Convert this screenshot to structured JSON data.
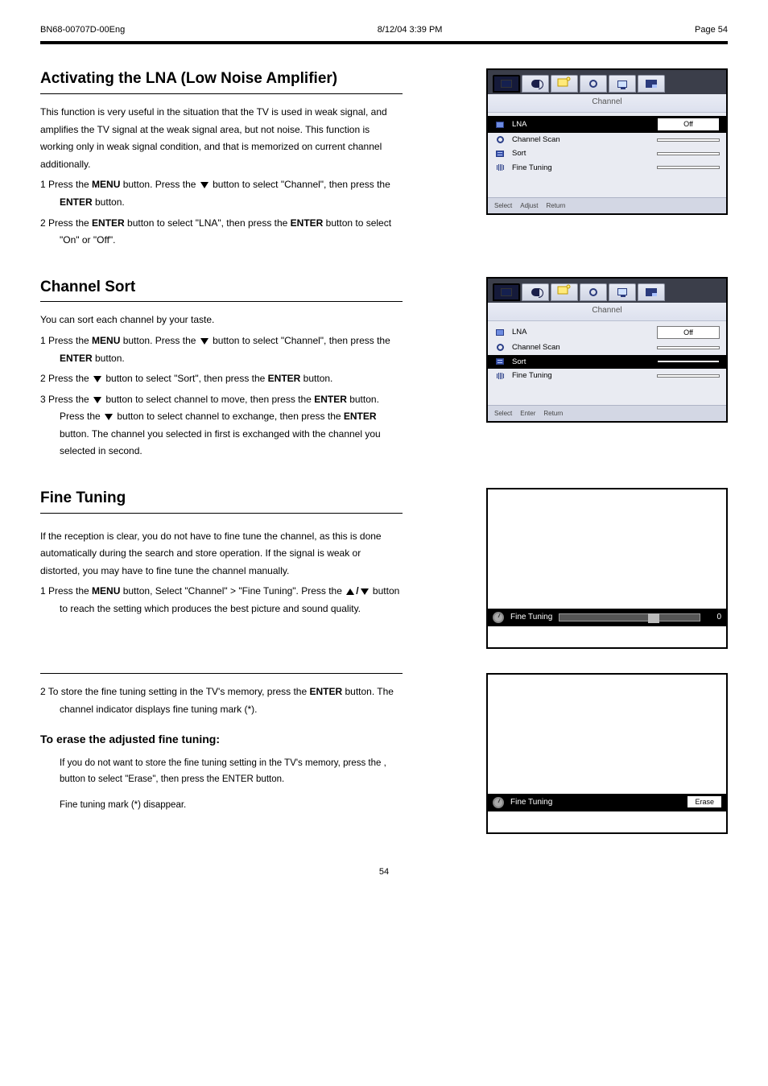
{
  "header": {
    "left": "BN68-00707D-00Eng",
    "middle": "8/12/04 3:39 PM",
    "right": "Page 54"
  },
  "section1": {
    "heading": "Activating the LNA (Low Noise Amplifier)",
    "intro": "This function is very useful in the situation that the TV is used in weak signal, and amplifies the TV signal at the weak signal area, but not noise.  This function is working only in weak signal condition, and that is memorized on current channel additionally.",
    "step1_pre": "1  Press the ",
    "menu": "MENU",
    "step1_mid": " button.\nPress the ",
    "step1_mid2": " button to select \"Channel\", then press\nthe ",
    "enter": "ENTER",
    "step1_end": " button.",
    "step2_pre": "2  Press the ",
    "step2_mid": " button to select \"LNA\", then press\nthe ",
    "step2_end": " button to select \"On\" or \"Off\"."
  },
  "osd1": {
    "title": "Channel",
    "rows": [
      {
        "label": "LNA",
        "value": "Off",
        "highlight": true
      },
      {
        "label": "Channel Scan",
        "value": "",
        "highlight": false
      },
      {
        "label": "Sort",
        "value": "",
        "highlight": false
      },
      {
        "label": "Fine Tuning",
        "value": "",
        "highlight": false
      }
    ],
    "footer": [
      "Select",
      "Adjust",
      "Return"
    ]
  },
  "section2": {
    "heading": "Channel Sort",
    "intro": "You can sort each channel by your taste.",
    "step1": {
      "pre": "1  Press the ",
      "menu": "MENU",
      "mid1": " button.\nPress the ",
      "mid2": " button to select \"Channel\", then press\nthe ",
      "enter": "ENTER",
      "end": " button."
    },
    "step2_pre": "2  Press the ",
    "step2_mid": " button to select \"Sort\", then press the\n",
    "step2_end": " button.",
    "step3_pre": "3  Press the ",
    "step3_mid": " button to select channel to move, then\npress the ",
    "step3_mid2": " button.\nPress the ",
    "step3_mid3": " button to select channel to exchange, then\npress the ",
    "step3_end": " button.\nThe channel you selected in first is exchanged with the channel you selected in second."
  },
  "osd2": {
    "title": "Channel",
    "rows": [
      {
        "label": "LNA",
        "value": "Off",
        "highlight": false
      },
      {
        "label": "Channel Scan",
        "value": "",
        "highlight": false
      },
      {
        "label": "Sort",
        "value": "",
        "highlight": true
      },
      {
        "label": "Fine Tuning",
        "value": "",
        "highlight": false
      }
    ],
    "footer": [
      "Select",
      "Enter",
      "Return"
    ]
  },
  "section3": {
    "heading": "Fine Tuning",
    "intro": "If the reception is clear, you do not have to fine tune the channel, as this is done automatically during the search and store operation. If the signal is weak or distorted, you may have to fine tune the channel manually.",
    "step1": {
      "pre": "1  Press the ",
      "menu": "MENU",
      "mid": " button, Select \"Channel\" > \"Fine Tuning\".\nPress the ",
      "mid2": " button to reach the setting which produces\nthe best picture and sound quality."
    },
    "step2": {
      "pre": "2  To store the fine tuning setting in the TV's memory,\npress the ",
      "enter": "ENTER",
      "mid": " button. The channel indicator displays\nfine tuning mark (*)."
    },
    "to_erase_head": "To erase the adjusted fine tuning:",
    "to_erase_body1": "If you do not want to store the fine tuning setting in the TV's memory, press the , button to select \"Erase\", then press the ENTER button.",
    "to_erase_body2": "Fine tuning mark (*) disappear."
  },
  "preview1": {
    "label": "Fine Tuning",
    "value": "0"
  },
  "preview2": {
    "label": "Fine Tuning",
    "value": "Erase"
  },
  "page_number": "54"
}
